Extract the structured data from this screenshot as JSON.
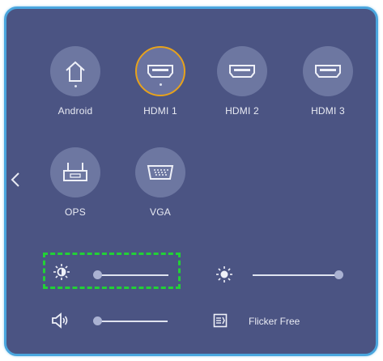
{
  "sources": [
    {
      "label": "Android",
      "icon": "home-icon",
      "active": false
    },
    {
      "label": "HDMI 1",
      "icon": "hdmi-icon",
      "active": true
    },
    {
      "label": "HDMI 2",
      "icon": "hdmi-icon",
      "active": false
    },
    {
      "label": "HDMI 3",
      "icon": "hdmi-icon",
      "active": false
    },
    {
      "label": "OPS",
      "icon": "ops-icon",
      "active": false
    },
    {
      "label": "VGA",
      "icon": "vga-icon",
      "active": false
    }
  ],
  "controls": {
    "brightness": {
      "icon": "brightness-icon",
      "level": 0
    },
    "contrast": {
      "icon": "contrast-icon",
      "level": 1
    },
    "volume": {
      "icon": "volume-icon",
      "level": 0
    },
    "flicker_free": {
      "icon": "flicker-free-icon",
      "label": "Flicker Free"
    }
  },
  "colors": {
    "panel": "#4b5483",
    "border": "#4aa6de",
    "active_ring": "#e7a21c",
    "highlight": "#22d136"
  }
}
